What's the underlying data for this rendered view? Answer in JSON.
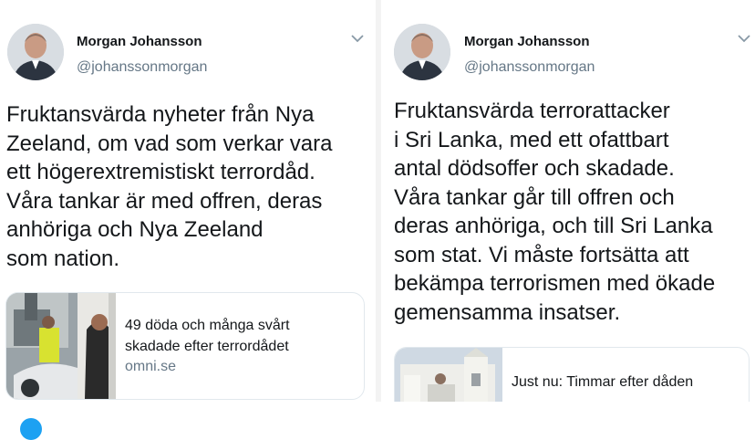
{
  "left_tweet": {
    "author_name": "Morgan Johansson",
    "author_handle": "@johanssonmorgan",
    "text": "Fruktansvärda nyheter från Nya\nZeeland, om vad som verkar vara\nett högerextremistiskt terrordåd.\nVåra tankar är med offren, deras\nanhöriga och Nya Zeeland\nsom nation.",
    "card": {
      "title": "49 döda och många svårt\nskadade efter terrordådet",
      "domain": "omni.se"
    }
  },
  "right_tweet": {
    "author_name": "Morgan Johansson",
    "author_handle": "@johanssonmorgan",
    "text": "Fruktansvärda terrorattacker\ni Sri Lanka, med ett ofattbart\nantal dödsoffer och skadade.\nVåra tankar går till offren och\nderas anhöriga, och till Sri Lanka\nsom stat. Vi måste fortsätta att\nbekämpa terrorismen med ökade\ngemensamma insatser.",
    "card": {
      "title": "Just nu: Timmar efter dåden"
    }
  },
  "colors": {
    "text": "#14171a",
    "secondary": "#657786",
    "border": "#e1e8ed",
    "accent": "#1da1f2"
  },
  "icons": [
    "avatar-photo",
    "chevron-down-icon"
  ]
}
